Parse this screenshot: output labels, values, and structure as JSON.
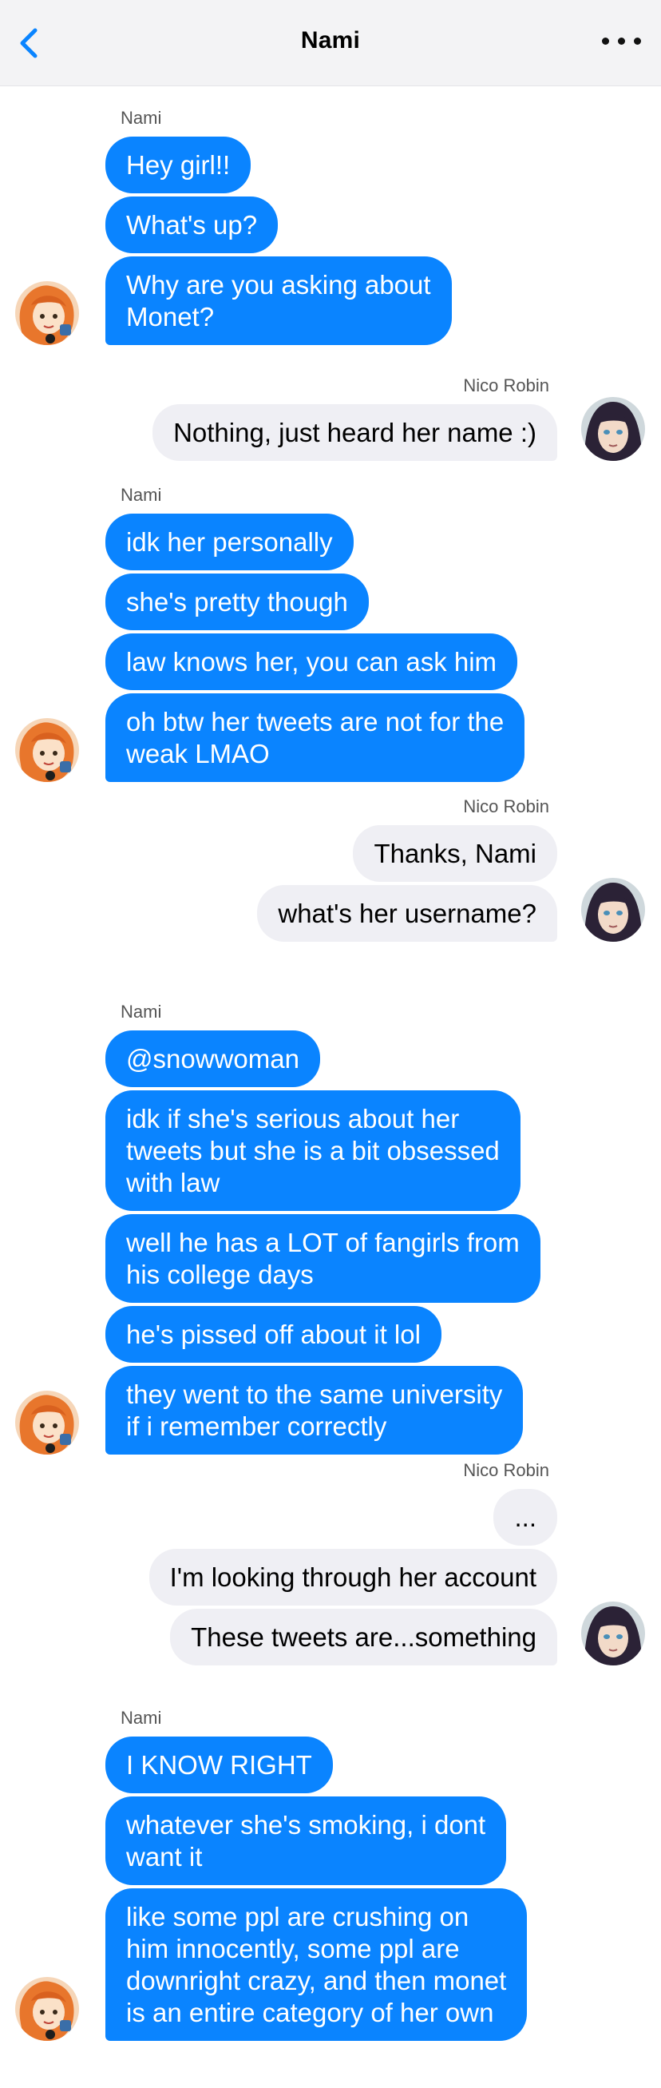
{
  "header": {
    "title": "Nami",
    "back_icon": "chevron-left-icon",
    "more_icon": "more-horizontal-icon",
    "accent_color": "#0a84ff"
  },
  "theme": {
    "incoming_bubble": "#0a84ff",
    "incoming_text": "#ffffff",
    "outgoing_bubble": "#efeff4",
    "outgoing_text": "#000000"
  },
  "messages": [
    {
      "sender": "Nami",
      "side": "incoming",
      "avatar": "nami-avatar",
      "texts": [
        [
          "Hey girl!!"
        ],
        [
          "What's up?"
        ],
        [
          "Why are you asking about",
          "Monet?"
        ]
      ]
    },
    {
      "sender": "Nico Robin",
      "side": "outgoing",
      "avatar": "nico-robin-avatar",
      "texts": [
        [
          "Nothing, just heard her name :)"
        ]
      ]
    },
    {
      "sender": "Nami",
      "side": "incoming",
      "avatar": "nami-avatar",
      "texts": [
        [
          "idk her personally"
        ],
        [
          "she's pretty though"
        ],
        [
          "law knows her, you can ask him"
        ],
        [
          "oh btw her tweets are not for the",
          "weak LMAO"
        ]
      ]
    },
    {
      "sender": "Nico Robin",
      "side": "outgoing",
      "avatar": "nico-robin-avatar",
      "texts": [
        [
          "Thanks, Nami"
        ],
        [
          "what's her username?"
        ]
      ]
    },
    {
      "sender": "Nami",
      "side": "incoming",
      "avatar": "nami-avatar",
      "texts": [
        [
          "@snowwoman"
        ],
        [
          "idk if she's serious about her",
          "tweets but she is a bit obsessed",
          "with law"
        ],
        [
          "well he has a LOT of fangirls from",
          "his college days"
        ],
        [
          "he's pissed off about it lol"
        ],
        [
          "they went to the same university",
          "if i remember correctly"
        ]
      ]
    },
    {
      "sender": "Nico Robin",
      "side": "outgoing",
      "avatar": "nico-robin-avatar",
      "texts": [
        [
          "..."
        ],
        [
          "I'm looking through her account"
        ],
        [
          "These tweets are...something"
        ]
      ]
    },
    {
      "sender": "Nami",
      "side": "incoming",
      "avatar": "nami-avatar",
      "texts": [
        [
          "I KNOW RIGHT"
        ],
        [
          "whatever she's smoking, i dont",
          "want it"
        ],
        [
          "like some ppl are crushing on",
          "him innocently, some ppl are",
          "downright crazy, and then monet",
          "is an entire category of her own"
        ]
      ]
    }
  ]
}
